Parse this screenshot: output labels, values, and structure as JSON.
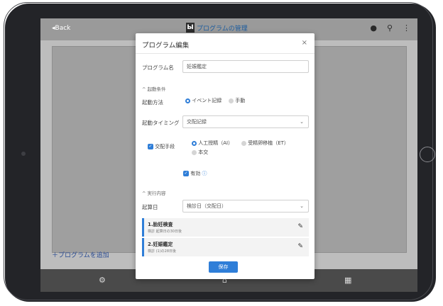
{
  "topbar": {
    "back": "◂Back",
    "title": "プログラムの管理",
    "logo_glyph": "Ы"
  },
  "topbar_icons": [
    "bell-icon",
    "search-icon",
    "more-vert-icon"
  ],
  "add_program": "＋プログラムを追加",
  "bottom_nav": [
    "gear-icon",
    "home-icon",
    "calendar-icon"
  ],
  "modal": {
    "title": "プログラム編集",
    "close": "×",
    "program_name_label": "プログラム名",
    "program_name_value": "妊娠鑑定",
    "start_condition_section": "^ 起動条件",
    "start_method_label": "起動方法",
    "start_method_options": [
      "イベント記録",
      "手動"
    ],
    "start_method_selected": "イベント記録",
    "start_timing_label": "起動タイミング",
    "start_timing_value": "交配記録",
    "mating_method_label": "交配手段",
    "mating_method_checked": true,
    "mating_options": [
      "人工授精（AI）",
      "受精卵移植（ET）",
      "本交"
    ],
    "mating_selected": "人工授精（AI）",
    "enabled_label": "有効",
    "enabled_checked": true,
    "exec_section": "^ 実行内容",
    "base_date_label": "起算日",
    "base_date_value": "検診日（交配日）",
    "tasks": [
      {
        "title": "1.胎妊検査",
        "sub": "検診 起算日の30日後"
      },
      {
        "title": "2.妊娠鑑定",
        "sub": "検診 (1)の28日後"
      }
    ],
    "save_label": "保存"
  },
  "colors": {
    "accent": "#2f7ed8",
    "topbar": "#9a9a9a",
    "bottombar": "#4a4a4a"
  }
}
